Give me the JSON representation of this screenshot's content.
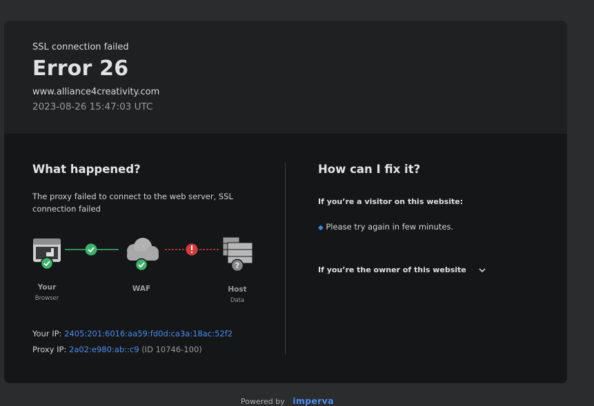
{
  "header": {
    "subtitle": "SSL connection failed",
    "error_title": "Error 26",
    "host": "www.alliance4creativity.com",
    "timestamp": "2023-08-26 15:47:03 UTC"
  },
  "what_happened": {
    "title": "What happened?",
    "description": "The proxy failed to connect to the web server, SSL connection failed"
  },
  "diagram": {
    "nodes": [
      {
        "label": "Your",
        "sublabel": "Browser",
        "status": "ok"
      },
      {
        "label": "WAF",
        "sublabel": "",
        "status": "ok"
      },
      {
        "label": "Host",
        "sublabel": "Data",
        "status": "unknown"
      }
    ],
    "links": [
      {
        "status": "ok"
      },
      {
        "status": "error"
      }
    ],
    "colors": {
      "ok": "#3bb36b",
      "error": "#d43c3c",
      "unknown": "#8a8a8a"
    }
  },
  "ips": {
    "your_ip_label": "Your IP:",
    "your_ip_value": "2405:201:6016:aa59:fd0d:ca3a:18ac:52f2",
    "proxy_ip_label": "Proxy IP:",
    "proxy_ip_value": "2a02:e980:ab::c9",
    "proxy_id": "(ID 10746-100)"
  },
  "fix": {
    "title": "How can I fix it?",
    "visitor_heading": "If you’re a visitor on this website:",
    "visitor_tip": "Please try again in few minutes.",
    "owner_heading": "If you’re the owner of this website"
  },
  "footer": {
    "powered_by": "Powered by",
    "brand": "imperva"
  },
  "colors": {
    "page_bg": "#2b2c2e",
    "link": "#4a8ff0"
  }
}
